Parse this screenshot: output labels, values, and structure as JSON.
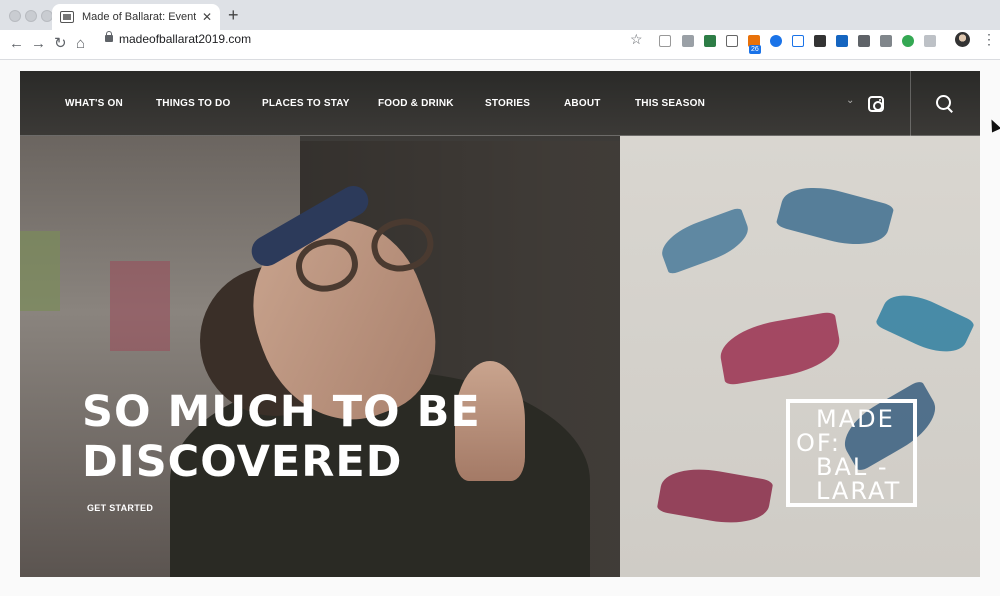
{
  "browser": {
    "tab_title": "Made of Ballarat: Events, Make",
    "tab_close": "✕",
    "new_tab": "+",
    "url": "madeofballarat2019.com",
    "extension_badge": "26"
  },
  "site": {
    "nav": [
      "WHAT'S ON",
      "THINGS TO DO",
      "PLACES TO STAY",
      "FOOD & DRINK",
      "STORIES",
      "ABOUT",
      "THIS SEASON"
    ],
    "headline": [
      "SO MUCH TO BE",
      "DISCOVERED"
    ],
    "cta": "GET STARTED",
    "logo_lines": [
      "MADE",
      "OF:",
      "BAL -",
      "LARAT"
    ]
  },
  "colors": {
    "nav_text": "#ffffff",
    "chrome_bg": "#dee1e6"
  },
  "icons": [
    "back-icon",
    "forward-icon",
    "reload-icon",
    "home-icon",
    "lock-icon",
    "star-icon",
    "instagram-icon",
    "search-icon",
    "chevron-down-icon",
    "menu-dots-icon"
  ]
}
